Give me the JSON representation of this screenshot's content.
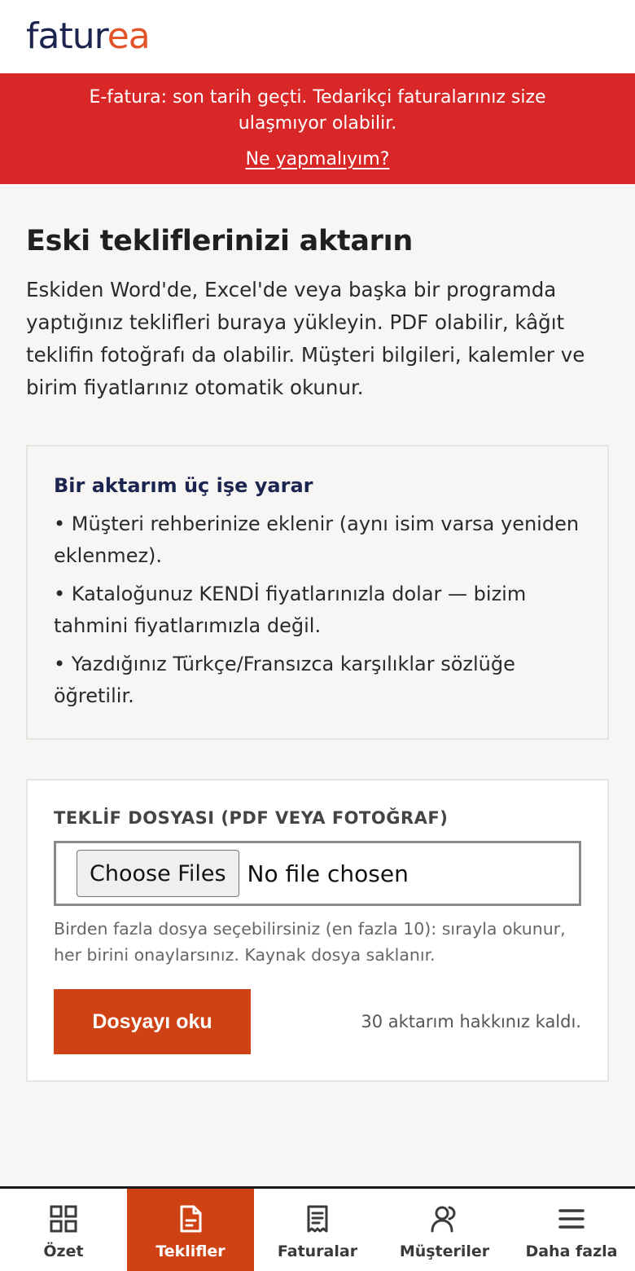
{
  "header": {
    "logo_part1": "fatur",
    "logo_part2": "ea"
  },
  "banner": {
    "message": "E-fatura: son tarih geçti. Tedarikçi faturalarınız size ulaşmıyor olabilir.",
    "link": "Ne yapmalıyım?"
  },
  "main": {
    "title": "Eski tekliflerinizi aktarın",
    "intro": "Eskiden Word'de, Excel'de veya başka bir programda yaptığınız teklifleri buraya yükleyin. PDF olabilir, kâğıt teklifin fotoğrafı da olabilir. Müşteri bilgileri, kalemler ve birim fiyatlarınız otomatik okunur."
  },
  "info_card": {
    "title": "Bir aktarım üç işe yarar",
    "items": [
      "• Müşteri rehberinize eklenir (aynı isim varsa yeniden eklenmez).",
      "• Kataloğunuz KENDİ fiyatlarınızla dolar — bizim tahmini fiyatlarımızla değil.",
      "• Yazdığınız Türkçe/Fransızca karşılıklar sözlüğe öğretilir."
    ]
  },
  "upload": {
    "label": "TEKLİF DOSYASI (PDF VEYA FOTOĞRAF)",
    "choose_button": "Choose Files",
    "no_file": "No file chosen",
    "hint": "Birden fazla dosya seçebilirsiniz (en fazla 10): sırayla okunur, her birini onaylarsınız. Kaynak dosya saklanır.",
    "submit_button": "Dosyayı oku",
    "quota": "30 aktarım hakkınız kaldı."
  },
  "nav": {
    "items": [
      {
        "label": "Özet",
        "icon": "grid-icon",
        "active": false
      },
      {
        "label": "Teklifler",
        "icon": "document-icon",
        "active": true
      },
      {
        "label": "Faturalar",
        "icon": "receipt-icon",
        "active": false
      },
      {
        "label": "Müşteriler",
        "icon": "users-icon",
        "active": false
      },
      {
        "label": "Daha fazla",
        "icon": "menu-icon",
        "active": false
      }
    ]
  },
  "colors": {
    "brand_navy": "#1b2550",
    "brand_orange": "#e4542b",
    "banner_red": "#d92727",
    "accent": "#cf4214"
  }
}
